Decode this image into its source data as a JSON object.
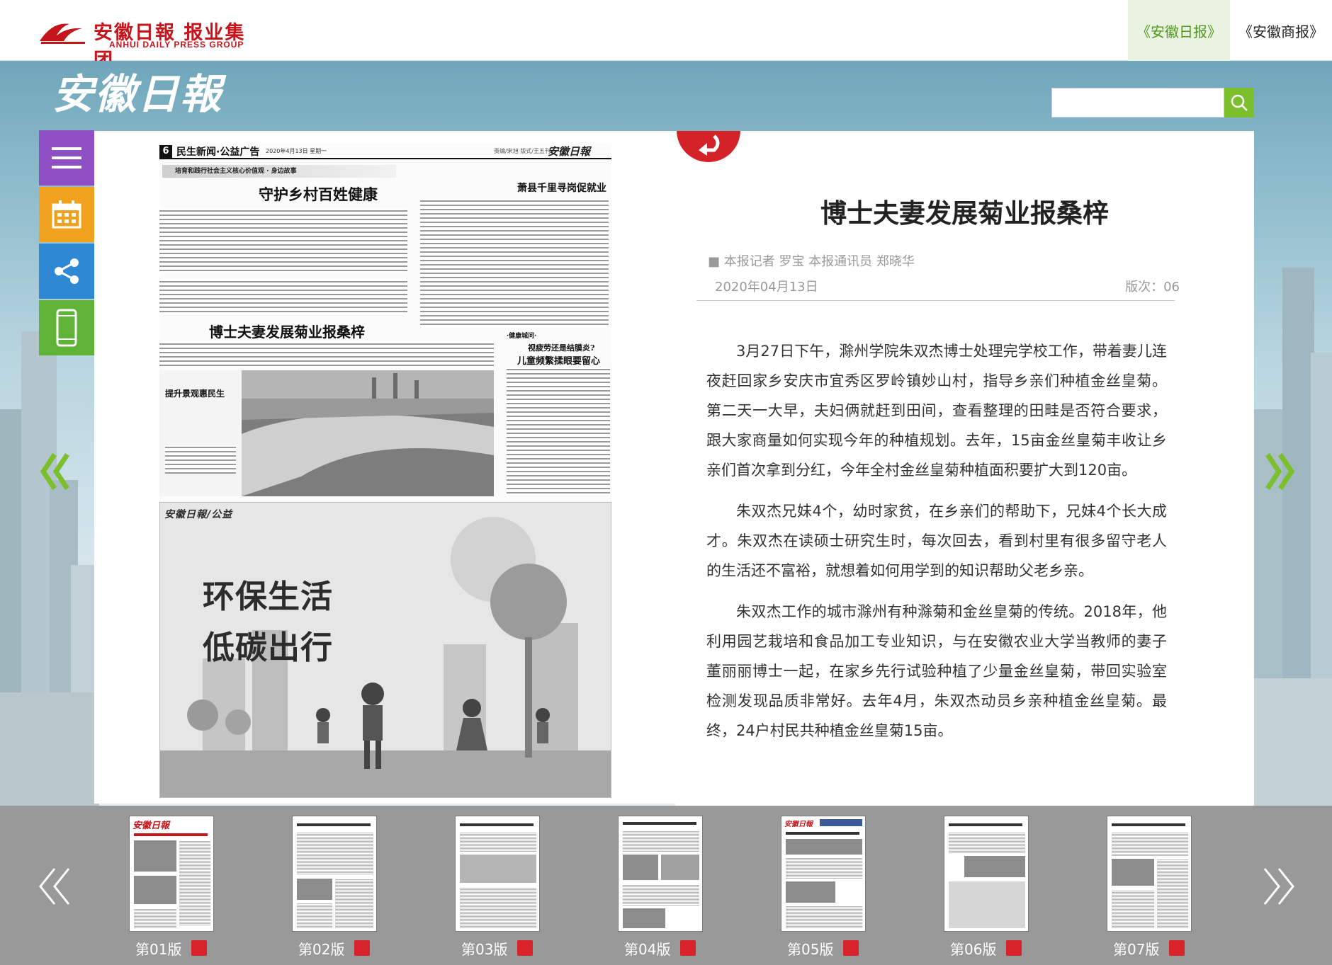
{
  "header": {
    "group_name_cn": "安徽日報 报业集团",
    "group_name_en": "ANHUI DAILY PRESS GROUP",
    "links": [
      {
        "label": "《安徽日报》",
        "active": true
      },
      {
        "label": "《安徽商报》",
        "active": false
      }
    ]
  },
  "masthead": {
    "title": "安徽日報",
    "search_value": ""
  },
  "side_menu": {
    "icons": [
      "menu-icon",
      "calendar-icon",
      "share-icon",
      "mobile-icon"
    ]
  },
  "newspaper": {
    "page_number": "6",
    "section": "民生新闻·公益广告",
    "date_line": "2020年4月13日 星期一",
    "edition_note": "责编/宋旭 版式/王五刊",
    "masthead_small": "安徽日報",
    "banner": "培育和践行社会主义核心价值观 · 身边故事",
    "headline_1": "守护乡村百姓健康",
    "headline_2": "博士夫妻发展菊业报桑梓",
    "headline_3": "萧县千里寻岗促就业",
    "subhead_1": "·健康城问·",
    "headline_4": "视疲劳还是结膜炎?",
    "headline_5": "儿童频繁揉眼要留心",
    "photo_caption": "提升景观惠民生",
    "ad_masthead": "安徽日報/公益",
    "ad_title_1": "环保生活",
    "ad_title_2": "低碳出行"
  },
  "article": {
    "title": "博士夫妻发展菊业报桑梓",
    "author": "■ 本报记者 罗宝 本报通讯员 郑晓华",
    "date": "2020年04月13日",
    "edition": "版次：06",
    "paragraphs": [
      "3月27日下午，滁州学院朱双杰博士处理完学校工作，带着妻儿连夜赶回家乡安庆市宜秀区罗岭镇妙山村，指导乡亲们种植金丝皇菊。第二天一大早，夫妇俩就赶到田间，查看整理的田畦是否符合要求，跟大家商量如何实现今年的种植规划。去年，15亩金丝皇菊丰收让乡亲们首次拿到分红，今年全村金丝皇菊种植面积要扩大到120亩。",
      "朱双杰兄妹4个，幼时家贫，在乡亲们的帮助下，兄妹4个长大成才。朱双杰在读硕士研究生时，每次回去，看到村里有很多留守老人的生活还不富裕，就想着如何用学到的知识帮助父老乡亲。",
      "朱双杰工作的城市滁州有种滁菊和金丝皇菊的传统。2018年，他利用园艺栽培和食品加工专业知识，与在安徽农业大学当教师的妻子董丽丽博士一起，在家乡先行试验种植了少量金丝皇菊，带回实验室检测发现品质非常好。去年4月，朱双杰动员乡亲种植金丝皇菊。最终，24户村民共种植金丝皇菊15亩。"
    ]
  },
  "thumbnails": [
    {
      "label": "第01版"
    },
    {
      "label": "第02版"
    },
    {
      "label": "第03版"
    },
    {
      "label": "第04版"
    },
    {
      "label": "第05版"
    },
    {
      "label": "第06版"
    },
    {
      "label": "第07版"
    }
  ],
  "colors": {
    "accent_green": "#7cbf2d",
    "brand_red": "#c4151c",
    "menu_purple": "#8e4fc4",
    "date_orange": "#f0a21f",
    "share_blue": "#2e88d4",
    "mobile_green": "#5fb336"
  }
}
